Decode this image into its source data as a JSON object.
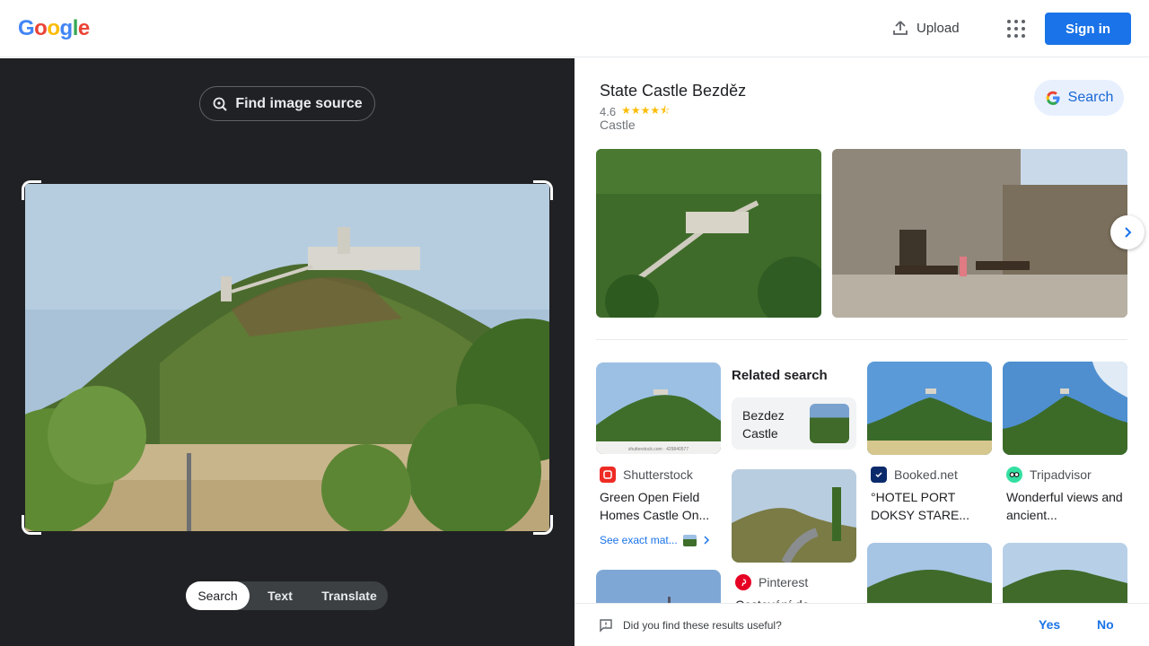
{
  "header": {
    "logo": [
      "G",
      "o",
      "o",
      "g",
      "l",
      "e"
    ],
    "upload_label": "Upload",
    "signin_label": "Sign in"
  },
  "lens": {
    "find_source_label": "Find image source",
    "modes": [
      "Search",
      "Text",
      "Translate"
    ]
  },
  "entity": {
    "title": "State Castle Bezděz",
    "rating": "4.6",
    "stars": "★★★★⯪",
    "category": "Castle",
    "search_label": "Search"
  },
  "results": [
    {
      "source": "Shutterstock",
      "caption": "Green Open Field Homes Castle On...",
      "thumb_caption": "shutterstock.com · 429840577"
    },
    {
      "source": "Booked.net",
      "caption": "°HOTEL PORT DOKSY STARE..."
    },
    {
      "source": "Tripadvisor",
      "caption": "Wonderful views and ancient..."
    },
    {
      "source": "Pinterest",
      "caption": "Cestování do..."
    }
  ],
  "related": {
    "heading": "Related search",
    "item": "Bezdez Castle"
  },
  "exact_matches_label": "See exact mat...",
  "feedback": {
    "question": "Did you find these results useful?",
    "yes": "Yes",
    "no": "No"
  },
  "colors": {
    "google_blue": "#4285F4",
    "google_red": "#EA4335",
    "google_yellow": "#FBBC05",
    "google_green": "#34A853",
    "link_blue": "#1a73e8",
    "dark_panel": "#202124"
  }
}
